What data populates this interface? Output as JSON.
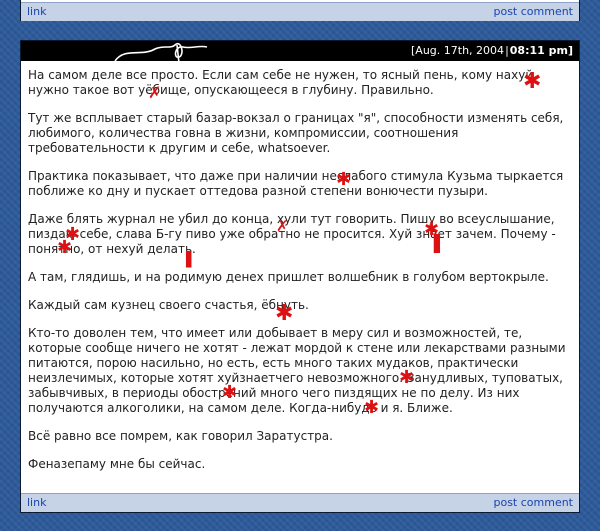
{
  "top_footer": {
    "link_label": "link",
    "post_comment_label": "post comment"
  },
  "entry": {
    "date": "[Aug. 17th, 2004",
    "separator": "|",
    "time": "08:11 pm]",
    "paragraphs": [
      "На самом деле все просто. Если сам себе не нужен, то ясный пень, кому нахуй нужно такое вот уёбище, опускающееся в глубину. Правильно.",
      "Тут же всплывает старый базар-вокзал о границах \"я\", способности изменять себя, любимого, количества говна в жизни, компромиссии, соотношения требовательности к другим и себе, whatsoever.",
      "Практика показывает, что даже при наличии неслабого стимула Кузьма тыркается поближе ко дну и пускает оттедова разной степени вонючести пузыри.",
      "Даже блять журнал не убил до конца, хули тут говорить. Пишу во всеуслышание, пиздаю себе, слава Б-гу пиво уже обратно не просится. Хуй знает зачем. Почему - понятно, от нехуй делать.",
      "А там, глядишь, и на родимую денех пришлет волшебник в голубом вертокрыле.",
      "Каждый сам кузнец своего счастья, ёбнуть.",
      "Кто-то доволен тем, что имеет или добывает в меру сил и возможностей, те, которые сообще ничего не хотят - лежат мордой к стене или лекарствами разными питаются, порою насильно, но есть, есть много таких мудаков, практически неизлечимых, которые хотят хуйзнаетчего невозможного. Занудливых, туповатых, забывчивых, в периоды обострений много чего пиздящих не по делу. Из них получаются алкоголики, на самом деле. Когда-нибудь и я. Ближе.",
      "Всё равно все помрем, как говорил Заратустра.",
      "Феназепаму мне бы сейчас."
    ]
  },
  "entry_footer": {
    "link_label": "link",
    "post_comment_label": "post comment"
  },
  "colors": {
    "background": "#2d5a9a",
    "header": "#000000",
    "footer": "#c6d2e6",
    "link": "#1a44b0",
    "censor_mark": "#dd1111"
  },
  "icons": {
    "header_doodle": "squiggle-doodle",
    "censor_marks": "red-scribble-censor"
  }
}
